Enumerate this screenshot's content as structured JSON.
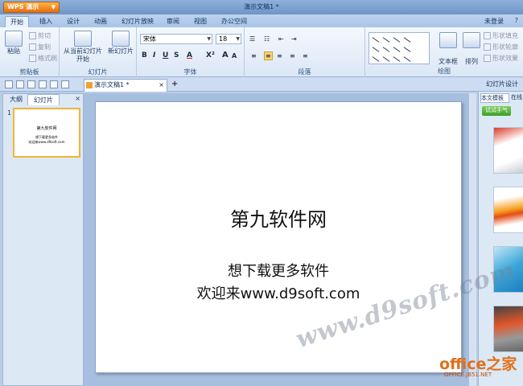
{
  "window": {
    "app_button": "WPS 演示",
    "title": "演示文稿1 *",
    "login": "未登录"
  },
  "ribbon_tabs": [
    "开始",
    "插入",
    "设计",
    "动画",
    "幻灯片放映",
    "审阅",
    "视图",
    "办公空间"
  ],
  "clipboard": {
    "paste": "粘贴",
    "cut": "剪切",
    "copy": "复制",
    "format_painter": "格式刷",
    "label": "剪贴板"
  },
  "slides_group": {
    "play_from_current_l1": "从当前幻灯片",
    "play_from_current_l2": "开始",
    "new_slide_l1": "新幻灯片",
    "label": "幻灯片"
  },
  "font_group": {
    "font_name": "宋体",
    "font_size": "18",
    "bold": "B",
    "italic": "I",
    "underline": "U",
    "shadow": "S",
    "font_color": "A",
    "superscript": "X²",
    "grow": "A",
    "shrink": "A",
    "label": "字体"
  },
  "paragraph_group": {
    "label": "段落"
  },
  "drawing_group": {
    "text_box": "文本框",
    "arrange": "排列",
    "fill": "形状填充",
    "outline": "形状轮廓",
    "effect": "形状效果",
    "label": "绘图"
  },
  "doc_tabs": {
    "current": "演示文稿1 *",
    "right_panel_title": "幻灯片设计"
  },
  "left_panel": {
    "tab_outline": "大纲",
    "tab_slides": "幻灯片",
    "close": "×",
    "slide_number": "1"
  },
  "thumbnail": {
    "line1": "第九软件网",
    "line2": "想下载更多软件",
    "line3": "欢迎来www.d9soft.com"
  },
  "slide": {
    "title": "第九软件网",
    "line1": "想下载更多软件",
    "line2": "欢迎来www.d9soft.com"
  },
  "right_panel": {
    "tab_local": "本文模板",
    "tab_online": "在线",
    "try_button": "试试手气"
  },
  "watermark": {
    "d9soft": "www.d9soft.com",
    "office": "office之家",
    "office_url": "OFFICE.JB51.NET"
  }
}
